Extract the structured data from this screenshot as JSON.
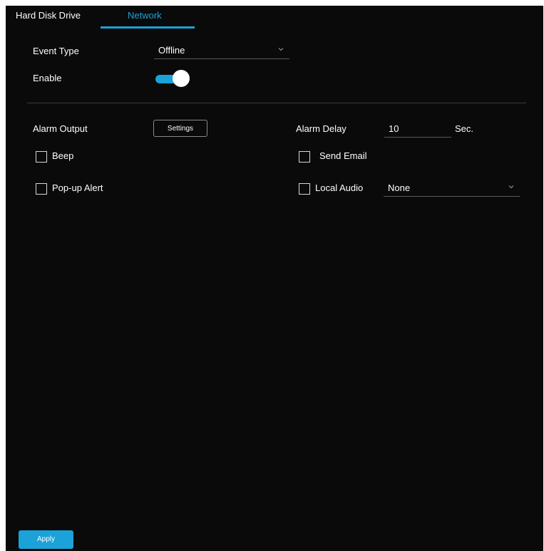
{
  "tabs": [
    {
      "label": "Hard Disk Drive",
      "active": false
    },
    {
      "label": "Network",
      "active": true
    }
  ],
  "accent_color": "#1ba2d9",
  "event_type": {
    "label": "Event Type",
    "value": "Offline"
  },
  "enable": {
    "label": "Enable",
    "on": true
  },
  "alarm_output": {
    "label": "Alarm Output",
    "button_label": "Settings"
  },
  "alarm_delay": {
    "label": "Alarm Delay",
    "value": "10",
    "unit": "Sec."
  },
  "beep": {
    "label": "Beep",
    "checked": false
  },
  "send_email": {
    "label": "Send Email",
    "checked": false
  },
  "popup_alert": {
    "label": "Pop-up Alert",
    "checked": false
  },
  "local_audio": {
    "label": "Local Audio",
    "checked": false,
    "value": "None"
  },
  "apply_label": "Apply"
}
